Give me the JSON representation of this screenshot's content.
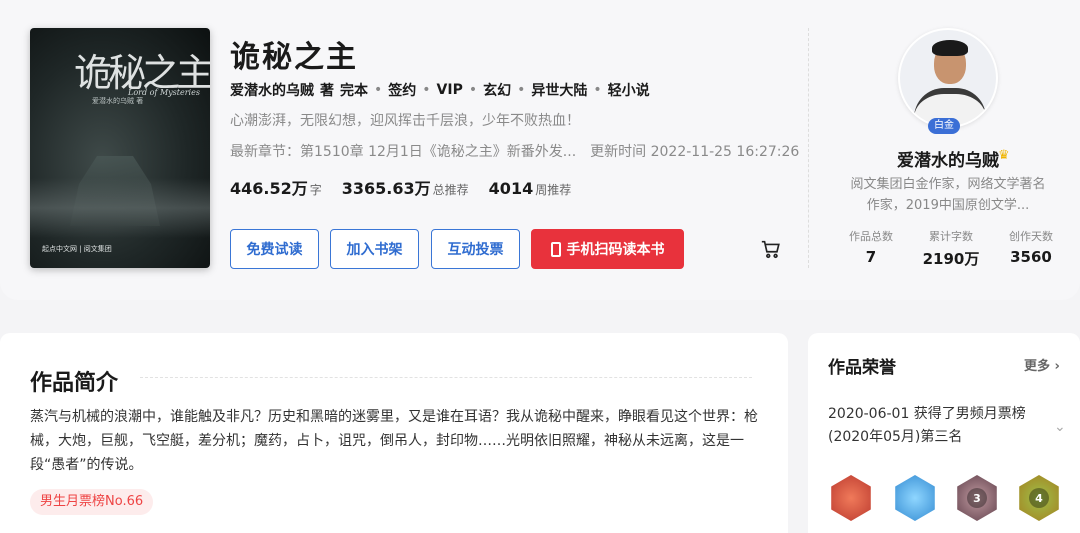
{
  "book": {
    "title": "诡秘之主",
    "cover_title": "诡秘之主",
    "cover_subtitle": "Lord of Mysteries",
    "cover_author": "爱潜水的乌贼 著",
    "cover_brand": "起点中文网 | 阅文集团",
    "author": "爱潜水的乌贼",
    "author_suffix": "著",
    "tags": [
      "完本",
      "签约",
      "VIP",
      "玄幻",
      "异世大陆",
      "轻小说"
    ],
    "slogan": "心潮澎湃，无限幻想，迎风挥击千层浪，少年不败热血！",
    "latest_chapter": "最新章节：第1510章 12月1日《诡秘之主》新番外发...",
    "update_time": "更新时间 2022-11-25 16:27:26",
    "stats": [
      {
        "num": "446.52万",
        "unit": "字"
      },
      {
        "num": "3365.63万",
        "unit": "总推荐"
      },
      {
        "num": "4014",
        "unit": "周推荐"
      }
    ]
  },
  "buttons": {
    "read": "免费试读",
    "shelf": "加入书架",
    "vote": "互动投票",
    "scan": "手机扫码读本书"
  },
  "author_panel": {
    "badge": "白金",
    "name": "爱潜水的乌贼",
    "desc": "阅文集团白金作家，网络文学著名作家，2019中国原创文学...",
    "stats": [
      {
        "label": "作品总数",
        "value": "7"
      },
      {
        "label": "累计字数",
        "value": "2190万"
      },
      {
        "label": "创作天数",
        "value": "3560"
      }
    ]
  },
  "intro": {
    "title": "作品简介",
    "text": "蒸汽与机械的浪潮中，谁能触及非凡？历史和黑暗的迷雾里，又是谁在耳语？我从诡秘中醒来，睁眼看见这个世界：枪械，大炮，巨舰，飞空艇，差分机；魔药，占卜，诅咒，倒吊人，封印物……光明依旧照耀，神秘从未远离，这是一段“愚者”的传说。",
    "tag": "男生月票榜No.66"
  },
  "honor": {
    "title": "作品荣誉",
    "more": "更多",
    "item": "2020-06-01 获得了男频月票榜(2020年05月)第三名",
    "medals": [
      "",
      "",
      "3",
      "4"
    ]
  },
  "colors": {
    "accent_blue": "#3a76d6",
    "scan_red": "#e8323c",
    "tag_red": "#e44444",
    "badge_blue": "#3b6fd6"
  }
}
